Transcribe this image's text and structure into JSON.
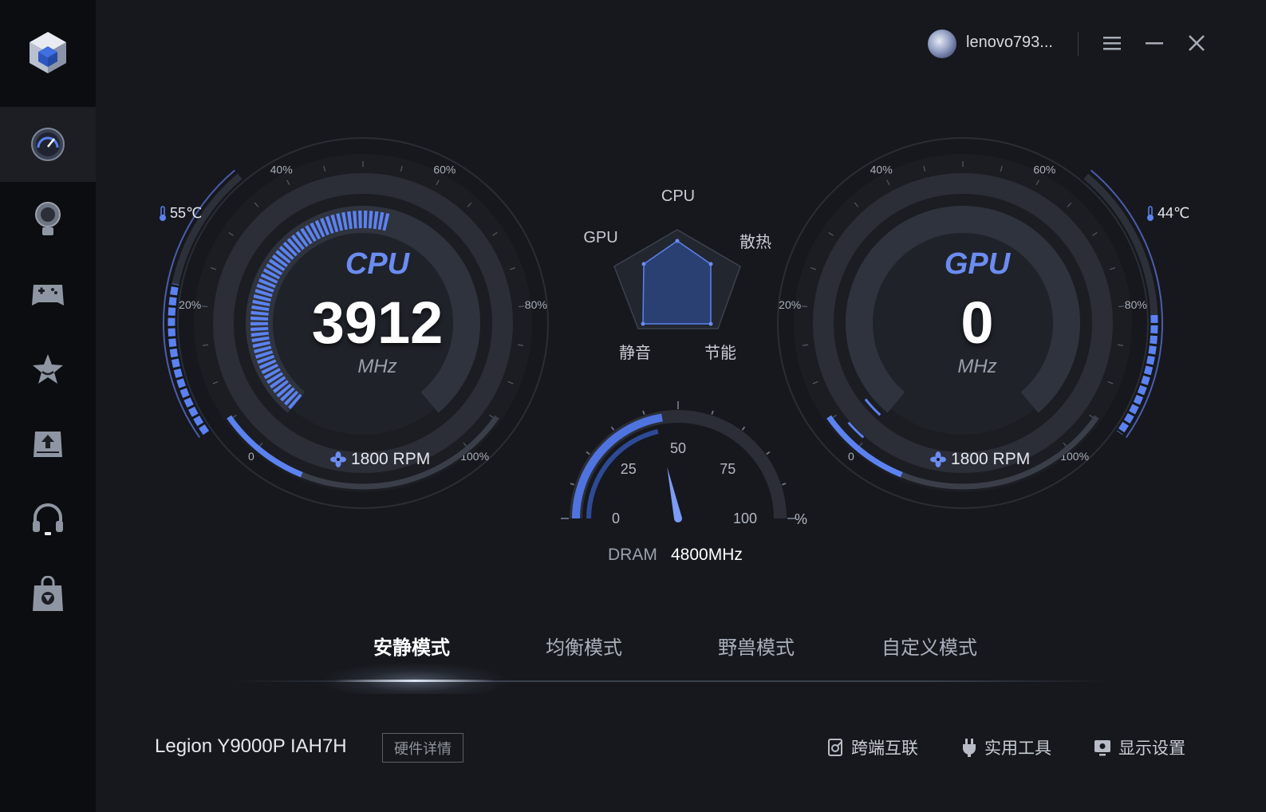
{
  "user": {
    "name": "lenovo793..."
  },
  "window_controls": {
    "menu_icon": "menu-icon",
    "minimize_icon": "minimize-icon",
    "close_icon": "close-icon"
  },
  "sidebar": {
    "items": [
      {
        "icon": "dashboard-icon",
        "active": true
      },
      {
        "icon": "lightbulb-icon",
        "active": false
      },
      {
        "icon": "gamepad-icon",
        "active": false
      },
      {
        "icon": "star-icon",
        "active": false
      },
      {
        "icon": "upload-icon",
        "active": false
      },
      {
        "icon": "headset-icon",
        "active": false
      },
      {
        "icon": "shopping-bag-icon",
        "active": false
      }
    ]
  },
  "cpu": {
    "label": "CPU",
    "value": "3912",
    "unit": "MHz",
    "temp": "55℃",
    "fan": "1800 RPM",
    "scale": [
      "0",
      "20%",
      "40%",
      "60%",
      "80%",
      "100%"
    ],
    "load_fraction": 0.55,
    "fan_fraction": 0.3,
    "temp_fraction": 0.55
  },
  "gpu": {
    "label": "GPU",
    "value": "0",
    "unit": "MHz",
    "temp": "44℃",
    "fan": "1800 RPM",
    "scale": [
      "0",
      "20%",
      "40%",
      "60%",
      "80%",
      "100%"
    ],
    "load_fraction": 0.02,
    "fan_fraction": 0.3,
    "temp_fraction": 0.44
  },
  "radar": {
    "labels": {
      "top": "CPU",
      "left": "GPU",
      "right": "散热",
      "bottom_left": "静音",
      "bottom_right": "节能"
    }
  },
  "dram": {
    "label": "DRAM",
    "value": "4800MHz",
    "unit": "%",
    "scale": [
      "0",
      "25",
      "50",
      "75",
      "100"
    ],
    "percent": 45
  },
  "modes": {
    "tabs": [
      "安静模式",
      "均衡模式",
      "野兽模式",
      "自定义模式"
    ],
    "active_index": 0
  },
  "footer": {
    "model": "Legion Y9000P IAH7H",
    "hw_detail": "硬件详情",
    "links": [
      "跨端互联",
      "实用工具",
      "显示设置"
    ]
  },
  "colors": {
    "accent": "#5b82f0",
    "bg": "#16181d",
    "sidebar": "#0c0d10"
  }
}
